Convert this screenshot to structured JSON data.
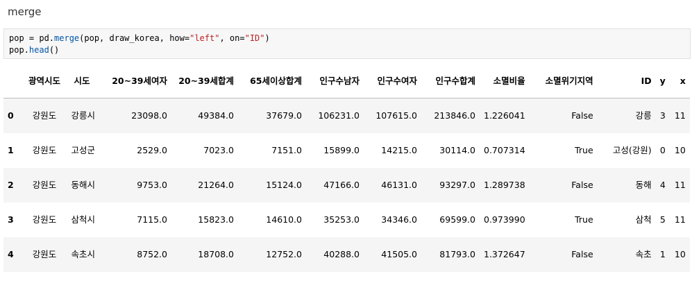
{
  "heading": "merge",
  "code": {
    "line1": {
      "a": "pop = pd.",
      "fn": "merge",
      "b": "(pop, draw_korea, how=",
      "s1": "\"left\"",
      "c": ", on=",
      "s2": "\"ID\"",
      "d": ")"
    },
    "line2": {
      "a": "pop.",
      "fn": "head",
      "b": "()"
    }
  },
  "table": {
    "columns": [
      "",
      "광역시도",
      "시도",
      "20~39세여자",
      "20~39세합계",
      "65세이상합계",
      "인구수남자",
      "인구수여자",
      "인구수합계",
      "소멸비율",
      "소멸위기지역",
      "ID",
      "y",
      "x"
    ],
    "rows": [
      [
        "0",
        "강원도",
        "강릉시",
        "23098.0",
        "49384.0",
        "37679.0",
        "106231.0",
        "107615.0",
        "213846.0",
        "1.226041",
        "False",
        "강릉",
        "3",
        "11"
      ],
      [
        "1",
        "강원도",
        "고성군",
        "2529.0",
        "7023.0",
        "7151.0",
        "15899.0",
        "14215.0",
        "30114.0",
        "0.707314",
        "True",
        "고성(강원)",
        "0",
        "10"
      ],
      [
        "2",
        "강원도",
        "동해시",
        "9753.0",
        "21264.0",
        "15124.0",
        "47166.0",
        "46131.0",
        "93297.0",
        "1.289738",
        "False",
        "동해",
        "4",
        "11"
      ],
      [
        "3",
        "강원도",
        "삼척시",
        "7115.0",
        "15823.0",
        "14610.0",
        "35253.0",
        "34346.0",
        "69599.0",
        "0.973990",
        "True",
        "삼척",
        "5",
        "11"
      ],
      [
        "4",
        "강원도",
        "속초시",
        "8752.0",
        "18708.0",
        "12752.0",
        "40288.0",
        "41505.0",
        "81793.0",
        "1.372647",
        "False",
        "속초",
        "1",
        "10"
      ]
    ]
  }
}
